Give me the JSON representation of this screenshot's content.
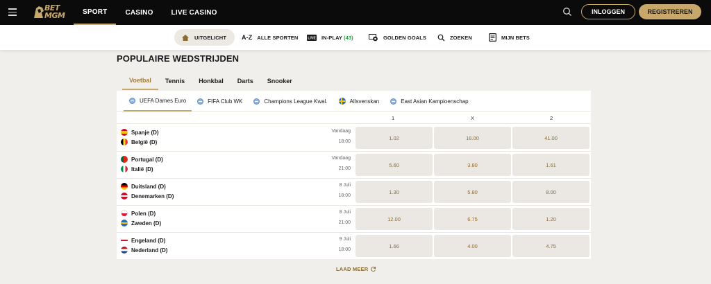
{
  "brand": {
    "logo_text": "BET MGM",
    "accent": "#c8a86a"
  },
  "topnav": {
    "items": [
      "SPORT",
      "CASINO",
      "LIVE CASINO"
    ],
    "active": 0
  },
  "auth": {
    "login_label": "INLOGGEN",
    "register_label": "REGISTREREN"
  },
  "subnav": {
    "items": [
      {
        "label": "UITGELICHT",
        "icon": "home-icon"
      },
      {
        "label": "ALLE SPORTEN",
        "icon": "az-icon"
      },
      {
        "label": "IN-PLAY",
        "count": "(43)",
        "icon": "live-icon"
      },
      {
        "label": "GOLDEN GOALS",
        "icon": "goal-icon"
      },
      {
        "label": "ZOEKEN",
        "icon": "search-icon"
      },
      {
        "label": "MIJN BETS",
        "icon": "betslip-icon"
      }
    ]
  },
  "main": {
    "title": "POPULAIRE WEDSTRIJDEN",
    "sport_tabs": [
      "Voetbal",
      "Tennis",
      "Honkbal",
      "Darts",
      "Snooker"
    ],
    "competition_tabs": [
      {
        "label": "UEFA Dames Euro",
        "icon": "globe-icon"
      },
      {
        "label": "FIFA Club WK",
        "icon": "globe-icon"
      },
      {
        "label": "Champions League Kwal.",
        "icon": "globe-icon"
      },
      {
        "label": "Allsvenskan",
        "icon": "sweden-flag-icon"
      },
      {
        "label": "East Asian Kampioenschap",
        "icon": "globe-icon"
      }
    ],
    "odds_headers": [
      "1",
      "X",
      "2"
    ],
    "matches": [
      {
        "home": "Spanje (D)",
        "away": "België (D)",
        "day": "Vandaag",
        "time": "18:00",
        "odds": [
          "1.02",
          "16.00",
          "41.00"
        ]
      },
      {
        "home": "Portugal (D)",
        "away": "Italië (D)",
        "day": "Vandaag",
        "time": "21:00",
        "odds": [
          "5.60",
          "3.80",
          "1.61"
        ]
      },
      {
        "home": "Duitsland (D)",
        "away": "Denemarken (D)",
        "day": "8 Juli",
        "time": "18:00",
        "odds": [
          "1.30",
          "5.80",
          "8.00"
        ]
      },
      {
        "home": "Polen (D)",
        "away": "Zweden (D)",
        "day": "8 Juli",
        "time": "21:00",
        "odds": [
          "12.00",
          "6.75",
          "1.20"
        ]
      },
      {
        "home": "Engeland (D)",
        "away": "Nederland (D)",
        "day": "9 Juli",
        "time": "18:00",
        "odds": [
          "1.66",
          "4.00",
          "4.75"
        ]
      }
    ],
    "load_more": "LAAD MEER"
  }
}
